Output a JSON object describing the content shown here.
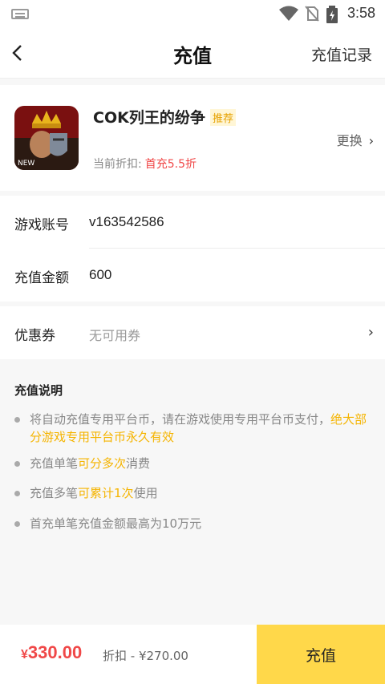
{
  "statusbar": {
    "time": "3:58"
  },
  "nav": {
    "title": "充值",
    "records": "充值记录"
  },
  "game": {
    "name": "COK列王的纷争",
    "badge": "推荐",
    "change": "更换",
    "discount_label": "当前折扣:",
    "discount_value": "首充5.5折",
    "icon_text": "NEW"
  },
  "form": {
    "account_label": "游戏账号",
    "account_value": "v163542586",
    "amount_label": "充值金额",
    "amount_value": "600"
  },
  "coupon": {
    "label": "优惠券",
    "value": "无可用券"
  },
  "description": {
    "title": "充值说明",
    "items": [
      {
        "plain1": "将自动充值专用平台币，请在游戏使用专用平台币支付，",
        "highlight": "绝大部分游戏专用平台币永久有效",
        "plain2": ""
      },
      {
        "plain1": "充值单笔",
        "highlight": "可分多次",
        "plain2": "消费"
      },
      {
        "plain1": "充值多笔",
        "highlight": "可累计1次",
        "plain2": "使用"
      },
      {
        "plain1": "首充单笔充值金额最高为10万元",
        "highlight": "",
        "plain2": ""
      }
    ]
  },
  "footer": {
    "currency": "¥",
    "price": "330.00",
    "discount_text": "折扣 - ¥270.00",
    "pay_label": "充值"
  },
  "colors": {
    "accent": "#ffd84a",
    "price": "#f04848",
    "highlight": "#f5b400"
  }
}
